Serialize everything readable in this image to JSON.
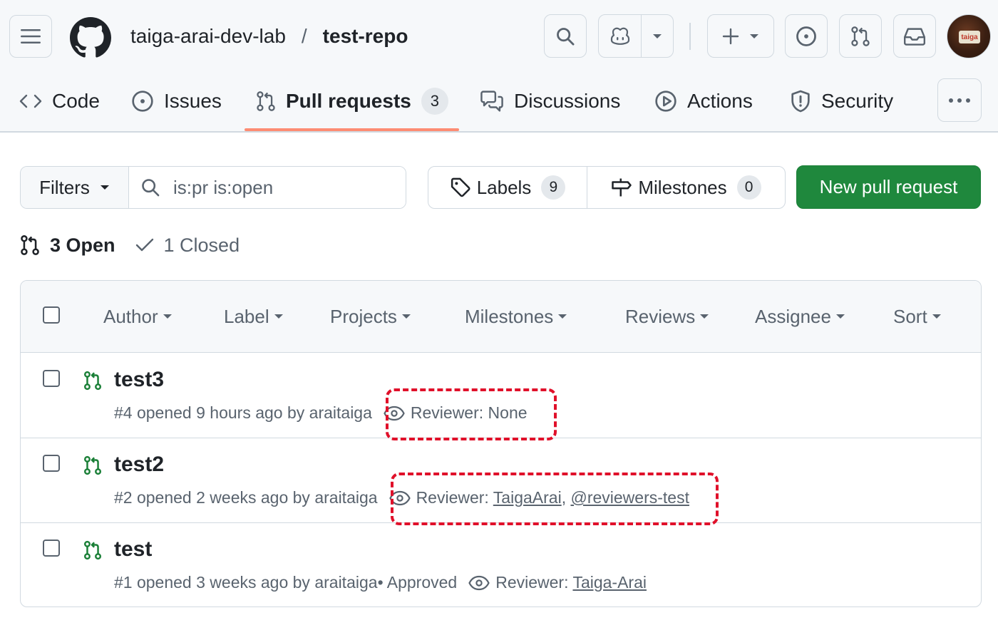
{
  "header": {
    "owner": "taiga-arai-dev-lab",
    "separator": "/",
    "repo": "test-repo",
    "avatar_text": "taiga"
  },
  "repo_nav": {
    "items": [
      {
        "label": "Code",
        "icon": "code-icon"
      },
      {
        "label": "Issues",
        "icon": "issue-opened-icon"
      },
      {
        "label": "Pull requests",
        "icon": "git-pull-request-icon",
        "count": "3",
        "selected": true
      },
      {
        "label": "Discussions",
        "icon": "comment-discussion-icon"
      },
      {
        "label": "Actions",
        "icon": "play-icon"
      },
      {
        "label": "Security",
        "icon": "shield-icon"
      }
    ]
  },
  "toolbar": {
    "filters_label": "Filters",
    "search_value": "is:pr is:open",
    "labels_label": "Labels",
    "labels_count": "9",
    "milestones_label": "Milestones",
    "milestones_count": "0",
    "new_pr_label": "New pull request"
  },
  "states": {
    "open_label": "3 Open",
    "closed_label": "1 Closed"
  },
  "list_header": {
    "filters": [
      "Author",
      "Label",
      "Projects",
      "Milestones",
      "Reviews",
      "Assignee",
      "Sort"
    ]
  },
  "pull_requests": [
    {
      "title": "test3",
      "meta": "#4 opened 9 hours ago by araitaiga",
      "reviewer_prefix": "Reviewer: ",
      "reviewer_text": "None"
    },
    {
      "title": "test2",
      "meta": "#2 opened 2 weeks ago by araitaiga",
      "reviewer_prefix": "Reviewer: ",
      "reviewer_1": "TaigaArai",
      "reviewer_sep": ", ",
      "reviewer_2": "@reviewers-test"
    },
    {
      "title": "test",
      "meta": "#1 opened 3 weeks ago by araitaiga",
      "status": " • Approved",
      "reviewer_prefix": "Reviewer: ",
      "reviewer_1": "Taiga-Arai"
    }
  ],
  "colors": {
    "accent_green": "#1f883d",
    "pr_open_green": "#1a7f37",
    "selected_underline": "#fd8c73",
    "annotation_red": "#e0102a"
  }
}
